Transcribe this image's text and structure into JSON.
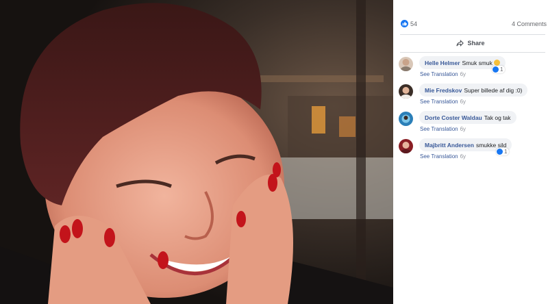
{
  "photo": {
    "alt": "Smiling woman with short dark red hair and red nail polish, hands on cheeks"
  },
  "stats": {
    "like_count": "54",
    "comments_count": "4 Comments"
  },
  "actions": {
    "share_label": "Share"
  },
  "comments": [
    {
      "author": "Helle Helmer",
      "text": "Smuk smuk",
      "emoji": "smiley-icon",
      "translate": "See Translation",
      "age": "6y",
      "reactions": "1"
    },
    {
      "author": "Mie Fredskov",
      "text": "Super billede af dig :0)",
      "translate": "See Translation",
      "age": "6y",
      "reactions": ""
    },
    {
      "author": "Dorte Coster Waldau",
      "text": "Tak og tak",
      "translate": "See Translation",
      "age": "6y",
      "reactions": ""
    },
    {
      "author": "Majbritt Andersen",
      "text": "smukke sild",
      "translate": "See Translation",
      "age": "6y",
      "reactions": "1"
    }
  ],
  "colors": {
    "link": "#385898",
    "like": "#1877f2",
    "bubble": "#f0f2f5",
    "nail": "#c3141b"
  }
}
